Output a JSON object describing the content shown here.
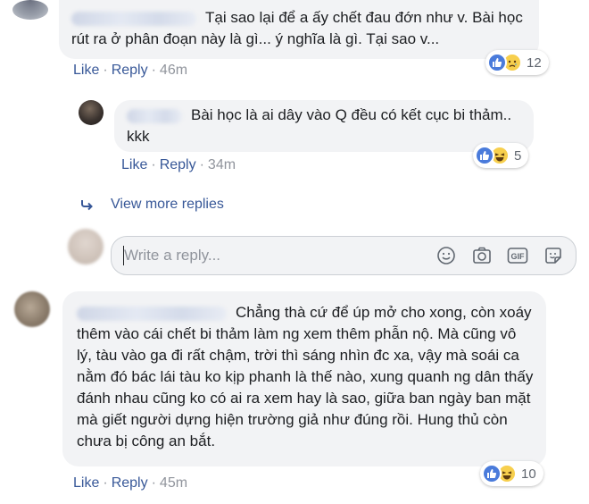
{
  "comments": [
    {
      "text": "Tại sao lại để a ấy chết đau đớn như v. Bài học rút ra ở phân đoạn này là gì... ý nghĩa là gì. Tại sao v...",
      "like": "Like",
      "reply": "Reply",
      "time": "46m",
      "reaction_count": "12"
    },
    {
      "text": "Bài học là ai dây vào Q đều có kết cục bi thảm.. kkk",
      "like": "Like",
      "reply": "Reply",
      "time": "34m",
      "reaction_count": "5"
    },
    {
      "text": "Chẳng thà cứ để úp mở cho xong, còn xoáy thêm vào cái chết bi thảm làm ng xem thêm phẫn nộ. Mà cũng vô lý, tàu vào ga đi rất chậm, trời thì sáng nhìn đc xa, vậy mà soái ca nằm đó bác lái tàu ko kịp phanh là thế nào, xung quanh ng dân thấy đánh nhau cũng ko có ai ra xem hay là sao, giữa ban ngày ban mặt mà giết người dựng hiện trường giả như đúng rồi. Hung thủ còn chưa bị công an bắt.",
      "like": "Like",
      "reply": "Reply",
      "time": "45m",
      "reaction_count": "10"
    }
  ],
  "view_more": "View more replies",
  "reply_box": {
    "placeholder": "Write a reply..."
  },
  "icons": {
    "like": "thumbs-up-icon",
    "sad": "sad-face-icon",
    "haha": "laugh-face-icon",
    "emoji": "smiley-icon",
    "camera": "camera-icon",
    "gif": "gif-icon",
    "sticker": "sticker-icon",
    "arrow": "reply-arrow-icon"
  },
  "colors": {
    "link": "#385898",
    "meta": "#90949c",
    "bubble": "#f2f3f5",
    "like_blue": "#4a7bdb",
    "emoji_yellow": "#f7cf4d"
  }
}
